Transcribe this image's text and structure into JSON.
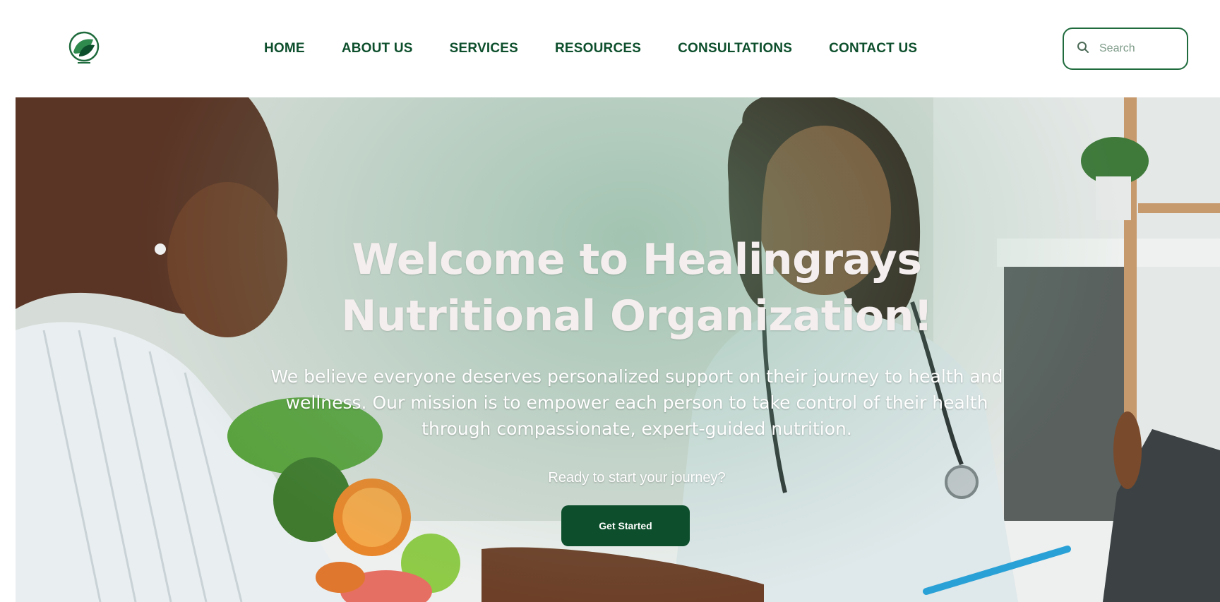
{
  "brand": {
    "logo_icon": "leaf-logo-icon",
    "accent": "#0d4f2c"
  },
  "nav": {
    "items": [
      {
        "label": "HOME"
      },
      {
        "label": "ABOUT US"
      },
      {
        "label": "SERVICES"
      },
      {
        "label": "RESOURCES"
      },
      {
        "label": "CONSULTATIONS"
      },
      {
        "label": "CONTACT US"
      }
    ]
  },
  "search": {
    "placeholder": "Search",
    "icon": "search-icon"
  },
  "hero": {
    "title": "Welcome to Healingrays Nutritional Organization!",
    "subtitle": "We believe everyone deserves personalized support on their journey to health and wellness. Our mission is to empower each person to take control of their health through compassionate, expert-guided nutrition.",
    "prompt": "Ready to start your journey?",
    "cta_label": "Get Started"
  }
}
